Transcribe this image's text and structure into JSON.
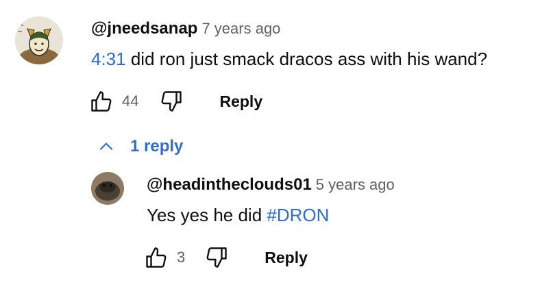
{
  "comment": {
    "author": "@jneedsanap",
    "time": "7 years ago",
    "timestamp_link": "4:31",
    "text": " did ron just smack dracos ass with his wand?",
    "likes": "44",
    "reply_label": "Reply",
    "avatar_icon": "loki-avatar"
  },
  "replies_toggle": {
    "label": "1 reply",
    "icon": "chevron-up-icon"
  },
  "reply": {
    "author": "@headintheclouds01",
    "time": "5 years ago",
    "text": "Yes yes he did ",
    "hashtag": "#DRON",
    "likes": "3",
    "reply_label": "Reply",
    "avatar_icon": "animal-avatar"
  },
  "colors": {
    "link": "#2f6bd3",
    "meta": "#606060",
    "text": "#0f0f0f"
  }
}
